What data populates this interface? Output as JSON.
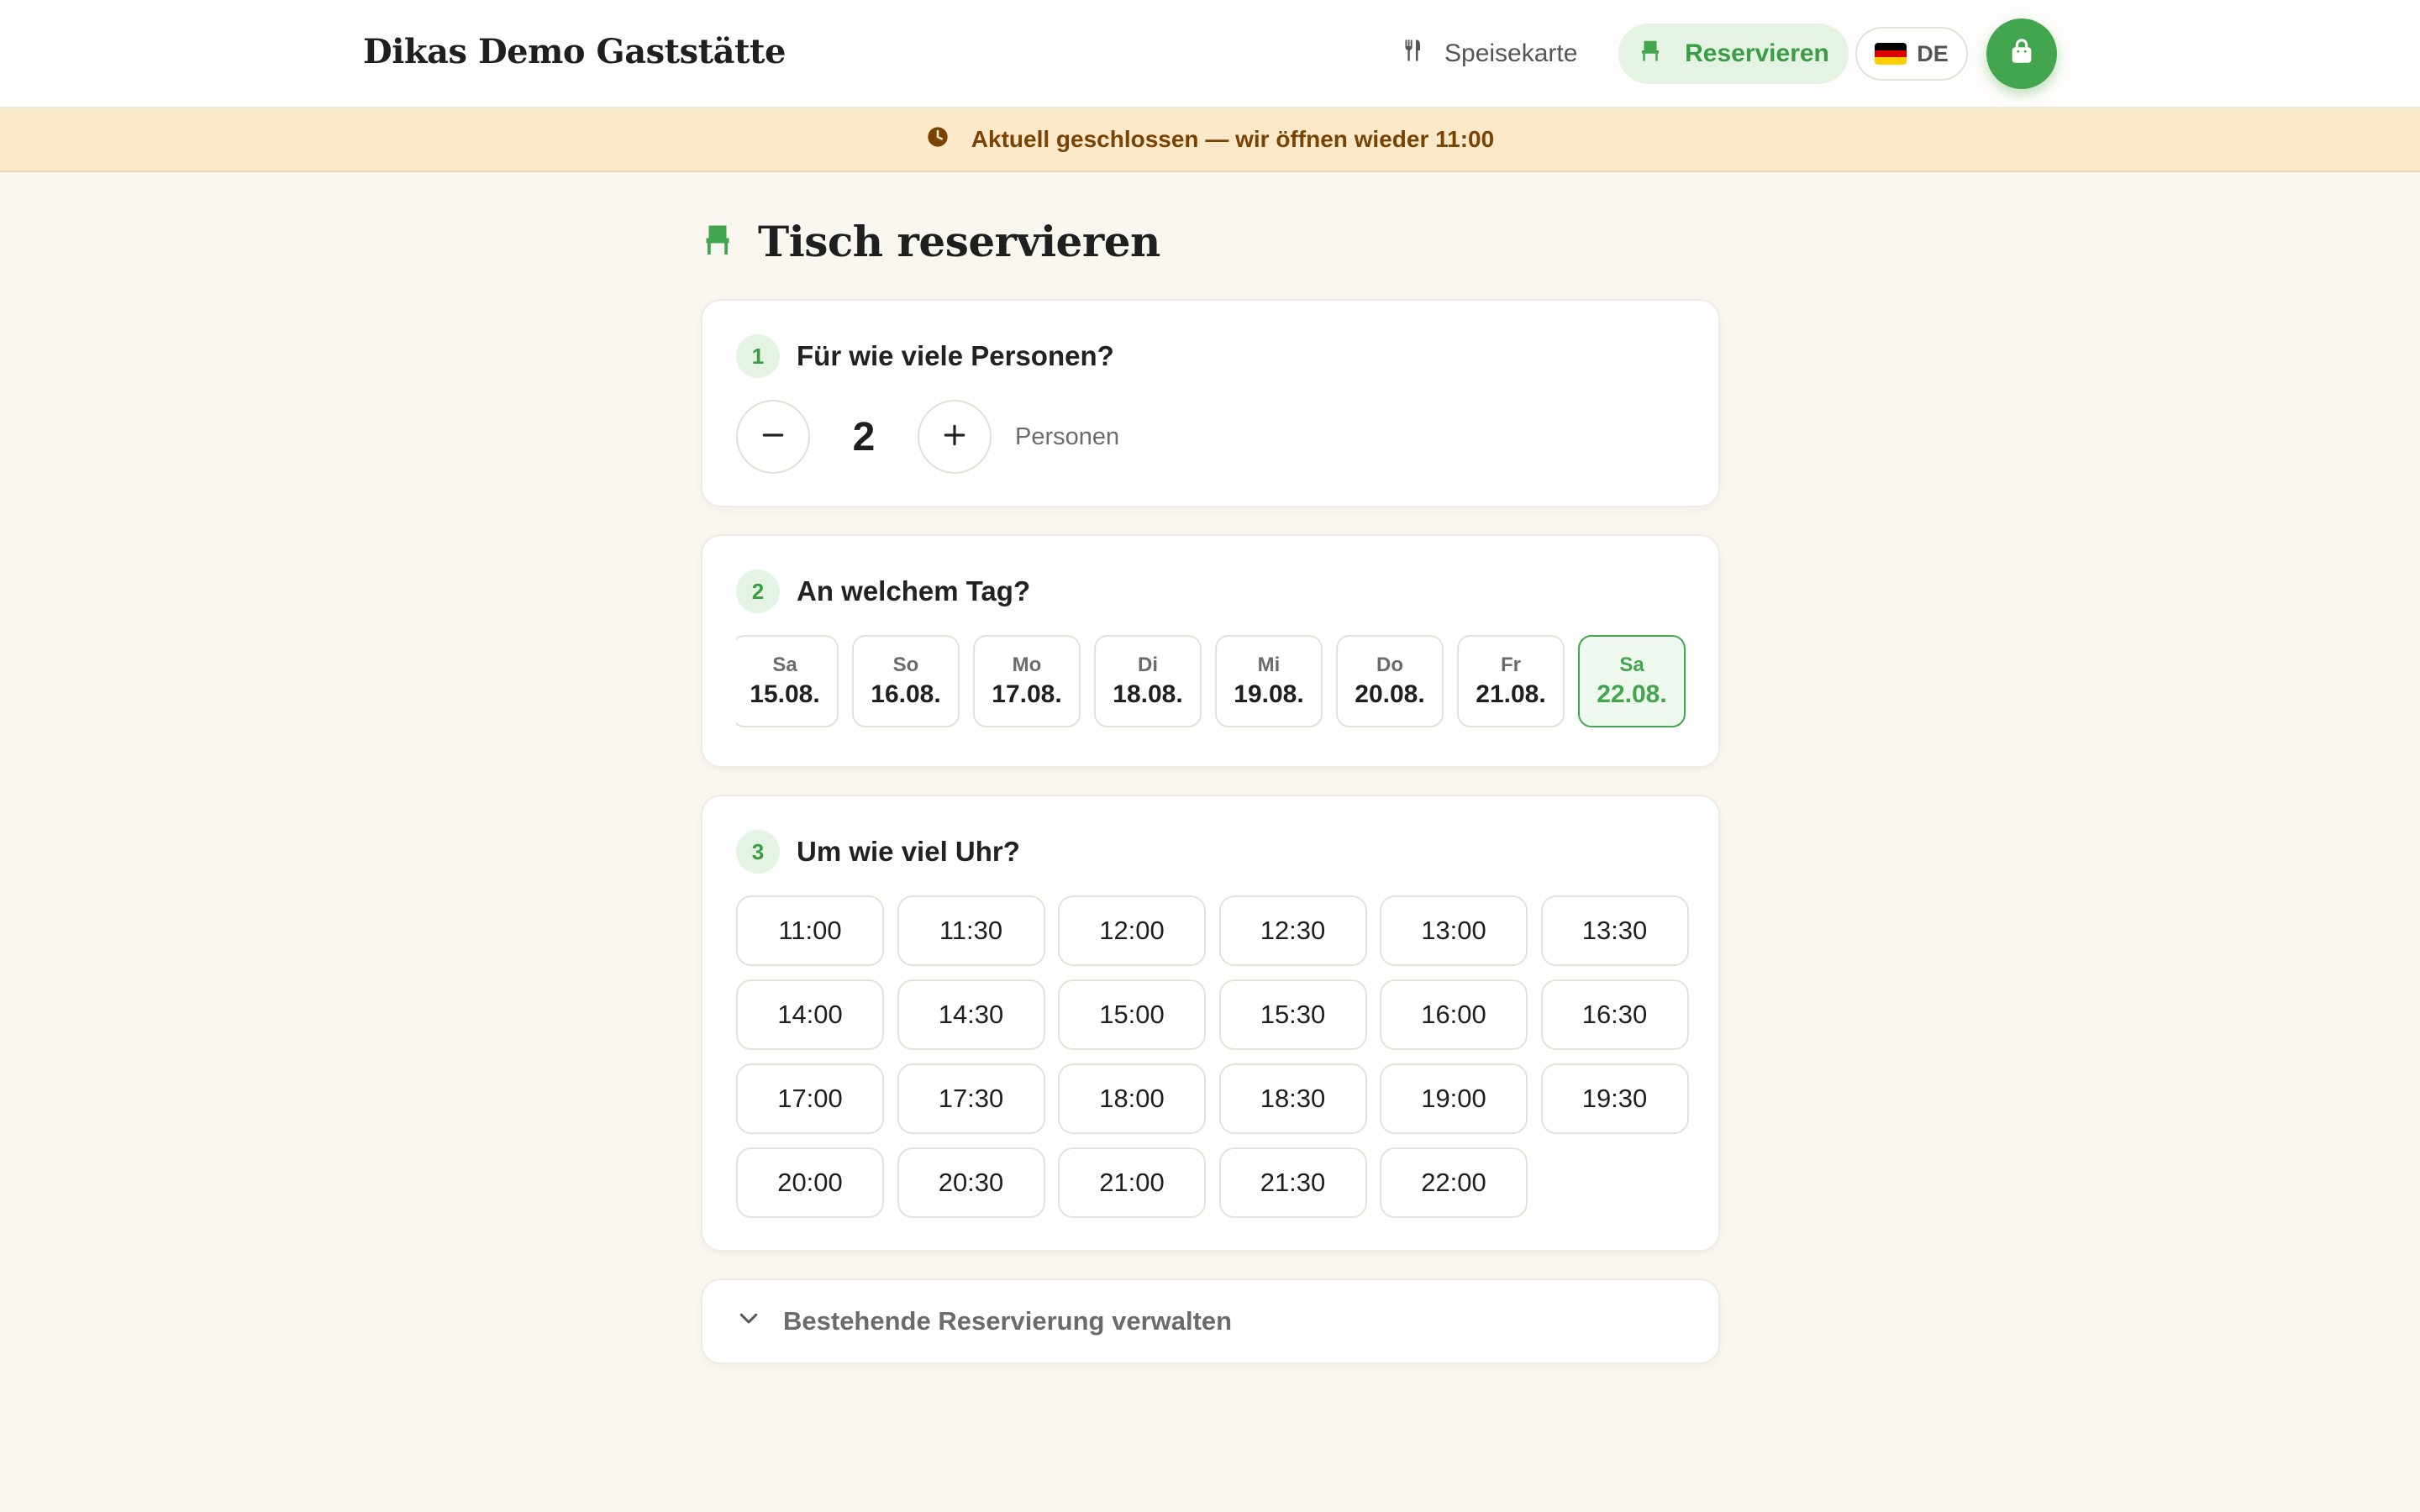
{
  "header": {
    "brand": "Dikas Demo Gaststätte",
    "nav_menu_label": "Speisekarte",
    "nav_reserve_label": "Reservieren",
    "lang_code": "DE",
    "accent_color": "#43a64e"
  },
  "banner": {
    "text": "Aktuell geschlossen — wir öffnen wieder 11:00",
    "icon": "clock-icon"
  },
  "page": {
    "title": "Tisch reservieren",
    "icon": "chair-icon"
  },
  "step1": {
    "number": "1",
    "title": "Für wie viele Personen?",
    "count": "2",
    "unit_label": "Personen"
  },
  "step2": {
    "number": "2",
    "title": "An welchem Tag?",
    "days": [
      {
        "name": "Sa",
        "date": "15.08.",
        "selected": false
      },
      {
        "name": "So",
        "date": "16.08.",
        "selected": false
      },
      {
        "name": "Mo",
        "date": "17.08.",
        "selected": false
      },
      {
        "name": "Di",
        "date": "18.08.",
        "selected": false
      },
      {
        "name": "Mi",
        "date": "19.08.",
        "selected": false
      },
      {
        "name": "Do",
        "date": "20.08.",
        "selected": false
      },
      {
        "name": "Fr",
        "date": "21.08.",
        "selected": false
      },
      {
        "name": "Sa",
        "date": "22.08.",
        "selected": true
      }
    ]
  },
  "step3": {
    "number": "3",
    "title": "Um wie viel Uhr?",
    "times": [
      "11:00",
      "11:30",
      "12:00",
      "12:30",
      "13:00",
      "13:30",
      "14:00",
      "14:30",
      "15:00",
      "15:30",
      "16:00",
      "16:30",
      "17:00",
      "17:30",
      "18:00",
      "18:30",
      "19:00",
      "19:30",
      "20:00",
      "20:30",
      "21:00",
      "21:30",
      "22:00"
    ]
  },
  "manage": {
    "label": "Bestehende Reservierung verwalten"
  }
}
